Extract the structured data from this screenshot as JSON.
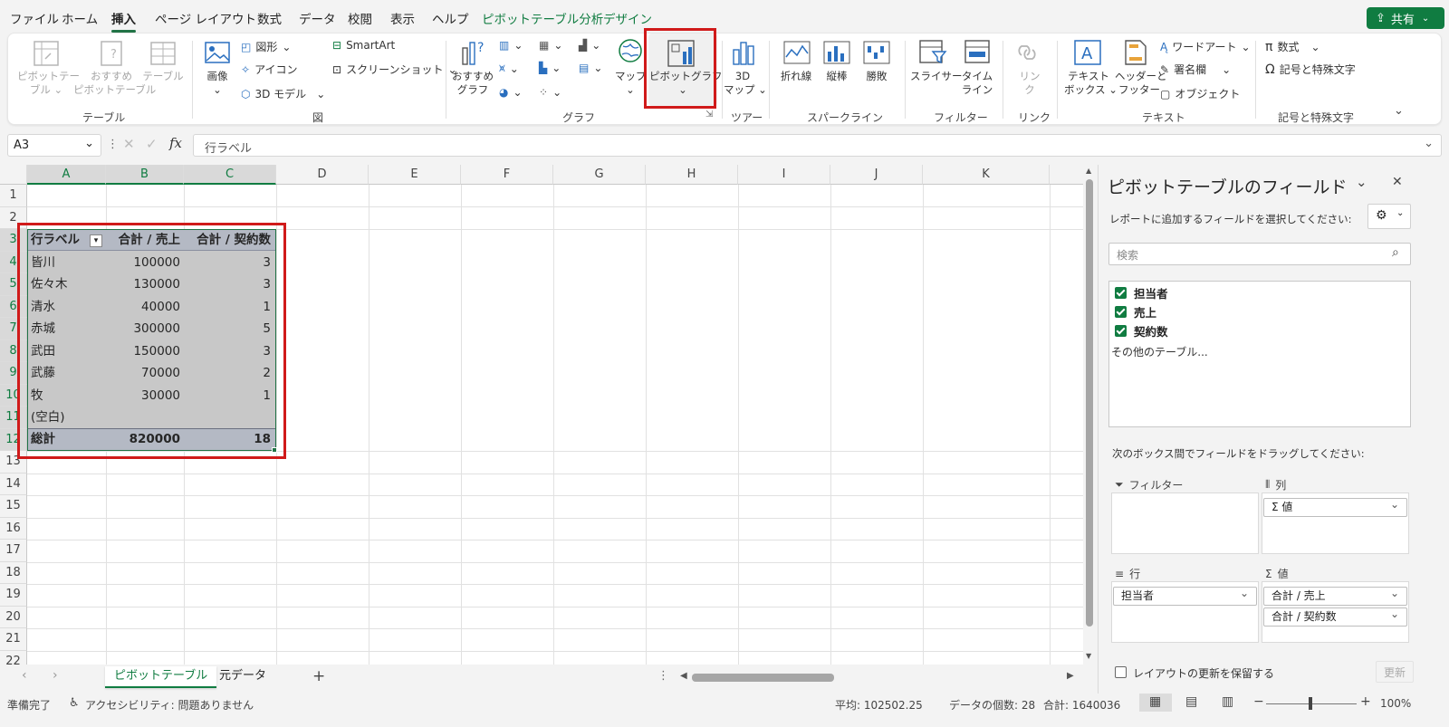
{
  "menu": {
    "items": [
      "ファイル",
      "ホーム",
      "挿入",
      "ページ レイアウト",
      "数式",
      "データ",
      "校閲",
      "表示",
      "ヘルプ",
      "ピボットテーブル分析",
      "デザイン"
    ],
    "active": "挿入",
    "share_label": "共有"
  },
  "ribbon": {
    "groups": {
      "table": "テーブル",
      "figure": "図",
      "graph": "グラフ",
      "tour": "ツアー",
      "sparkline": "スパークライン",
      "filter": "フィルター",
      "link": "リンク",
      "text": "テキスト",
      "symbols": "記号と特殊文字"
    },
    "table_btns": {
      "pivot": "ピボットテー\nブル ⌄",
      "recommended": "おすすめ\nピボットテーブル",
      "table": "テーブル"
    },
    "figure_btns": {
      "image": "画像",
      "shapes": "図形",
      "icons": "アイコン",
      "models": "3D モデル",
      "smartart": "SmartArt",
      "screenshot": "スクリーンショット"
    },
    "graph_btns": {
      "recommended": "おすすめ\nグラフ",
      "map": "マップ",
      "pivotchart": "ピボットグラフ"
    },
    "tour_btns": {
      "map3d": "3D\nマップ ⌄"
    },
    "sparkline_btns": [
      "折れ線",
      "縦棒",
      "勝敗"
    ],
    "filter_btns": [
      "スライサー",
      "タイム\nライン"
    ],
    "link_btns": {
      "link": "リン\nク"
    },
    "text_btns": {
      "textbox": "テキスト\nボックス ⌄",
      "headerfooter": "ヘッダーと\nフッター",
      "wordart": "ワードアート",
      "signature": "署名欄",
      "object": "オブジェクト"
    },
    "symbol_btns": {
      "equation": "数式",
      "symbol": "記号と特殊文字"
    }
  },
  "formula_bar": {
    "namebox": "A3",
    "content": "行ラベル",
    "fx": "fx"
  },
  "grid": {
    "columns": [
      "A",
      "B",
      "C",
      "D",
      "E",
      "F",
      "G",
      "H",
      "I",
      "J",
      "K"
    ],
    "rows": [
      "1",
      "2",
      "3",
      "4",
      "5",
      "6",
      "7",
      "8",
      "9",
      "10",
      "11",
      "12",
      "13",
      "14",
      "15",
      "16",
      "17",
      "18",
      "19",
      "20",
      "21",
      "22"
    ],
    "pivot": {
      "headers": [
        "行ラベル",
        "合計 / 売上",
        "合計 / 契約数"
      ],
      "rows": [
        [
          "皆川",
          "100000",
          "3"
        ],
        [
          "佐々木",
          "130000",
          "3"
        ],
        [
          "清水",
          "40000",
          "1"
        ],
        [
          "赤城",
          "300000",
          "5"
        ],
        [
          "武田",
          "150000",
          "3"
        ],
        [
          "武藤",
          "70000",
          "2"
        ],
        [
          "牧",
          "30000",
          "1"
        ],
        [
          "(空白)",
          "",
          ""
        ]
      ],
      "total": [
        "総計",
        "820000",
        "18"
      ]
    }
  },
  "sheets": {
    "tabs": [
      "ピボットテーブル",
      "元データ"
    ],
    "active": "ピボットテーブル"
  },
  "status": {
    "ready": "準備完了",
    "accessibility": "アクセシビリティ: 問題ありません",
    "average": "平均: 102502.25",
    "count": "データの個数: 28",
    "sum": "合計: 1640036",
    "zoom": "100%"
  },
  "pane": {
    "title": "ピボットテーブルのフィールド",
    "subtitle": "レポートに追加するフィールドを選択してください:",
    "search_placeholder": "検索",
    "fields": [
      "担当者",
      "売上",
      "契約数"
    ],
    "more_tables": "その他のテーブル...",
    "drag_hint": "次のボックス間でフィールドをドラッグしてください:",
    "areas": {
      "filter": "フィルター",
      "columns": "列",
      "rows": "行",
      "values": "値"
    },
    "columns_items": [
      "Σ 値"
    ],
    "rows_items": [
      "担当者"
    ],
    "values_items": [
      "合計 / 売上",
      "合計 / 契約数"
    ],
    "defer_label": "レイアウトの更新を保留する",
    "update_label": "更新"
  },
  "colors": {
    "accent": "#107c41",
    "highlight": "#d01a1a",
    "pivot_fill": "#c8c8c8",
    "pivot_header": "#b4b9c4"
  }
}
